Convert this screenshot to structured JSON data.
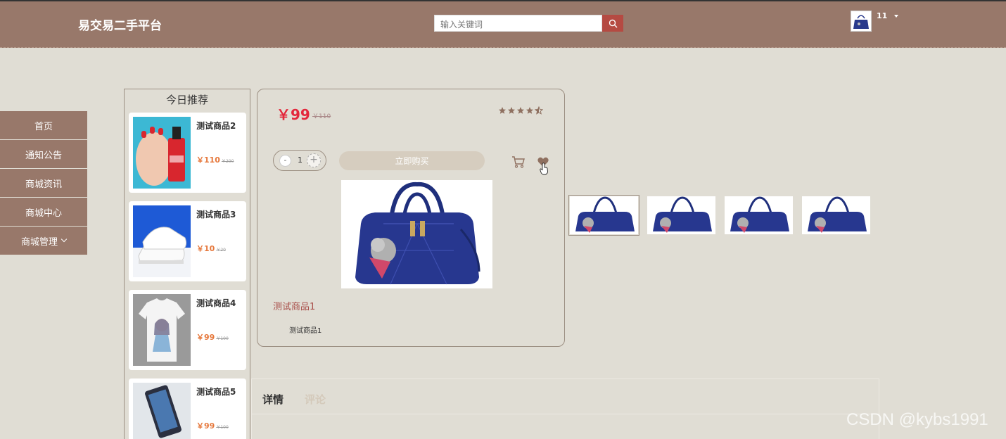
{
  "header": {
    "brand": "易交易二手平台",
    "search_placeholder": "输入关键词",
    "username": "11"
  },
  "sidenav": {
    "items": [
      {
        "label": "首页"
      },
      {
        "label": "通知公告"
      },
      {
        "label": "商城资讯"
      },
      {
        "label": "商城中心"
      },
      {
        "label": "商城管理"
      }
    ]
  },
  "recommend": {
    "title": "今日推荐",
    "items": [
      {
        "name": "测试商品2",
        "price": "￥110",
        "old_price": "￥200"
      },
      {
        "name": "测试商品3",
        "price": "￥10",
        "old_price": "￥20"
      },
      {
        "name": "测试商品4",
        "price": "￥99",
        "old_price": "￥100"
      },
      {
        "name": "测试商品5",
        "price": "￥99",
        "old_price": "￥100"
      }
    ]
  },
  "product": {
    "price": "￥99",
    "old_price": "￥110",
    "rating": 4.5,
    "quantity": "1",
    "minus_label": "-",
    "plus_label": "+",
    "buy_label": "立即购买",
    "title": "测试商品1",
    "description": "测试商品1"
  },
  "tabs": [
    {
      "label": "详情"
    },
    {
      "label": "评论"
    }
  ],
  "watermark": "CSDN @kybs1991",
  "colors": {
    "header": "#98786a",
    "background": "#e0ddd4",
    "price_red": "#e3283c",
    "rec_price": "#e6783c",
    "search_button": "#b54a42"
  }
}
